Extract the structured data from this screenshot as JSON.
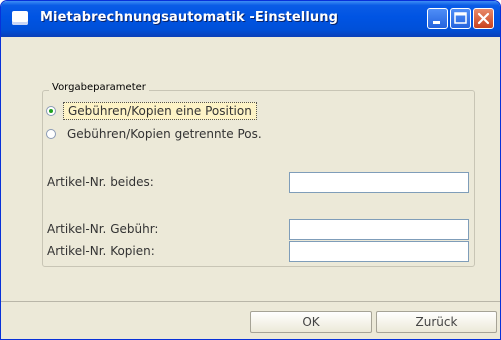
{
  "window": {
    "title": "Mietabrechnungsautomatik -Einstellung"
  },
  "group": {
    "legend": "Vorgabeparameter",
    "options": [
      {
        "label": "Gebühren/Kopien eine Position",
        "selected": true
      },
      {
        "label": "Gebühren/Kopien getrennte Pos.",
        "selected": false
      }
    ]
  },
  "fields": {
    "artikel_beides": {
      "label": "Artikel-Nr. beides:",
      "value": ""
    },
    "artikel_gebuehr": {
      "label": "Artikel-Nr. Gebühr:",
      "value": ""
    },
    "artikel_kopien": {
      "label": "Artikel-Nr. Kopien:",
      "value": ""
    }
  },
  "buttons": {
    "ok": "OK",
    "back": "Zurück"
  }
}
